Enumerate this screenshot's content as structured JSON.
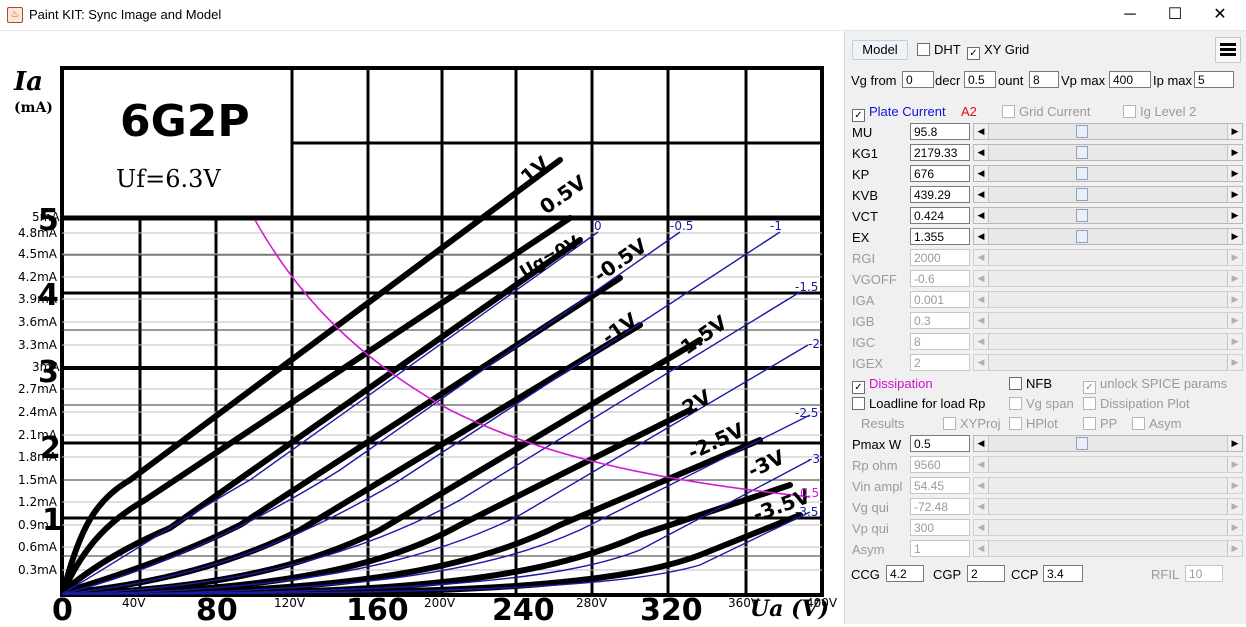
{
  "window": {
    "title": "Paint KIT: Sync Image and Model",
    "minimize": "─",
    "maximize": "☐",
    "close": "✕"
  },
  "scan": {
    "tube_name": "6G2P",
    "heater": "Uf=6.3V",
    "y_unit_top": "Ia",
    "y_unit_bottom": "(mA)",
    "x_unit": "Ua (V)",
    "hand_x_labels": [
      "0",
      "80",
      "160",
      "240",
      "320"
    ],
    "hand_y_labels": [
      "5",
      "4",
      "3",
      "2",
      "1"
    ],
    "curve_labels": [
      "1V",
      "0.5V",
      "Ug=0V",
      "-0.5V",
      "-1V",
      "-1.5V",
      "-2V",
      "-2.5V",
      "-3V",
      "-3.5V"
    ]
  },
  "overlay": {
    "y_ticks": [
      "5mA",
      "4.8mA",
      "4.5mA",
      "4.2mA",
      "3.9mA",
      "3.6mA",
      "3.3mA",
      "3mA",
      "2.7mA",
      "2.4mA",
      "2.1mA",
      "1.8mA",
      "1.5mA",
      "1.2mA",
      "0.9mA",
      "0.6mA",
      "0.3mA"
    ],
    "x_ticks": [
      "40V",
      "120V",
      "200V",
      "280V",
      "360V",
      "400V"
    ],
    "curve_labels": [
      "0",
      "-0.5",
      "-1",
      "-1.5",
      "-2",
      "-2.5",
      "-3",
      "-3.5"
    ],
    "load_label": "0.5"
  },
  "toolbar": {
    "model_button": "Model",
    "dht_label": "DHT",
    "dht_checked": false,
    "xy_grid_label": "XY Grid",
    "xy_grid_checked": true,
    "menu_icon": "hamburger-menu-icon"
  },
  "range": {
    "vg_from_label": "Vg from",
    "vg_from": "0",
    "decr_label": "decr",
    "decr": "0.5",
    "count_label": "ount",
    "count": "8",
    "vp_max_label": "Vp max",
    "vp_max": "400",
    "ip_max_label": "Ip max",
    "ip_max": "5"
  },
  "curves": {
    "plate_current_label": "Plate Current",
    "plate_current_checked": true,
    "a2_label": "A2",
    "grid_current_label": "Grid Current",
    "grid_current_checked": false,
    "ig_level2_label": "Ig Level 2",
    "ig_level2_checked": false
  },
  "params": [
    {
      "name": "MU",
      "value": "95.8",
      "enabled": true
    },
    {
      "name": "KG1",
      "value": "2179.33",
      "enabled": true
    },
    {
      "name": "KP",
      "value": "676",
      "enabled": true
    },
    {
      "name": "KVB",
      "value": "439.29",
      "enabled": true
    },
    {
      "name": "VCT",
      "value": "0.424",
      "enabled": true
    },
    {
      "name": "EX",
      "value": "1.355",
      "enabled": true
    },
    {
      "name": "RGI",
      "value": "2000",
      "enabled": false
    },
    {
      "name": "VGOFF",
      "value": "-0.6",
      "enabled": false
    },
    {
      "name": "IGA",
      "value": "0.001",
      "enabled": false
    },
    {
      "name": "IGB",
      "value": "0.3",
      "enabled": false
    },
    {
      "name": "IGC",
      "value": "8",
      "enabled": false
    },
    {
      "name": "IGEX",
      "value": "2",
      "enabled": false
    }
  ],
  "options": {
    "dissipation_label": "Dissipation",
    "dissipation_checked": true,
    "nfb_label": "NFB",
    "nfb_checked": false,
    "unlock_label": "unlock SPICE params",
    "unlock_checked": true,
    "loadline_label": "Loadline for load Rp",
    "loadline_checked": false,
    "vg_span_label": "Vg span",
    "vg_span_checked": false,
    "diss_plot_label": "Dissipation Plot",
    "diss_plot_checked": false,
    "results_label": "Results",
    "xyproj_label": "XYProj",
    "hplot_label": "HPlot",
    "pp_label": "PP",
    "asym_label": "Asym"
  },
  "load": [
    {
      "name": "Pmax W",
      "value": "0.5",
      "enabled": true
    },
    {
      "name": "Rp ohm",
      "value": "9560",
      "enabled": false
    },
    {
      "name": "Vin ampl",
      "value": "54.45",
      "enabled": false
    },
    {
      "name": "Vg qui",
      "value": "-72.48",
      "enabled": false
    },
    {
      "name": "Vp qui",
      "value": "300",
      "enabled": false
    },
    {
      "name": "Asym",
      "value": "1",
      "enabled": false
    }
  ],
  "caps": {
    "ccg_label": "CCG",
    "ccg": "4.2",
    "cgp_label": "CGP",
    "cgp": "2",
    "ccp_label": "CCP",
    "ccp": "3.4",
    "rfil_label": "RFIL",
    "rfil": "10"
  },
  "colors": {
    "model_curve": "#1a1aa8",
    "dissipation_curve": "#d21bd2",
    "scan_ink": "#000000",
    "a2": "#e01010",
    "plate_current": "#1010e0",
    "dissipation_text": "#d010d0"
  }
}
